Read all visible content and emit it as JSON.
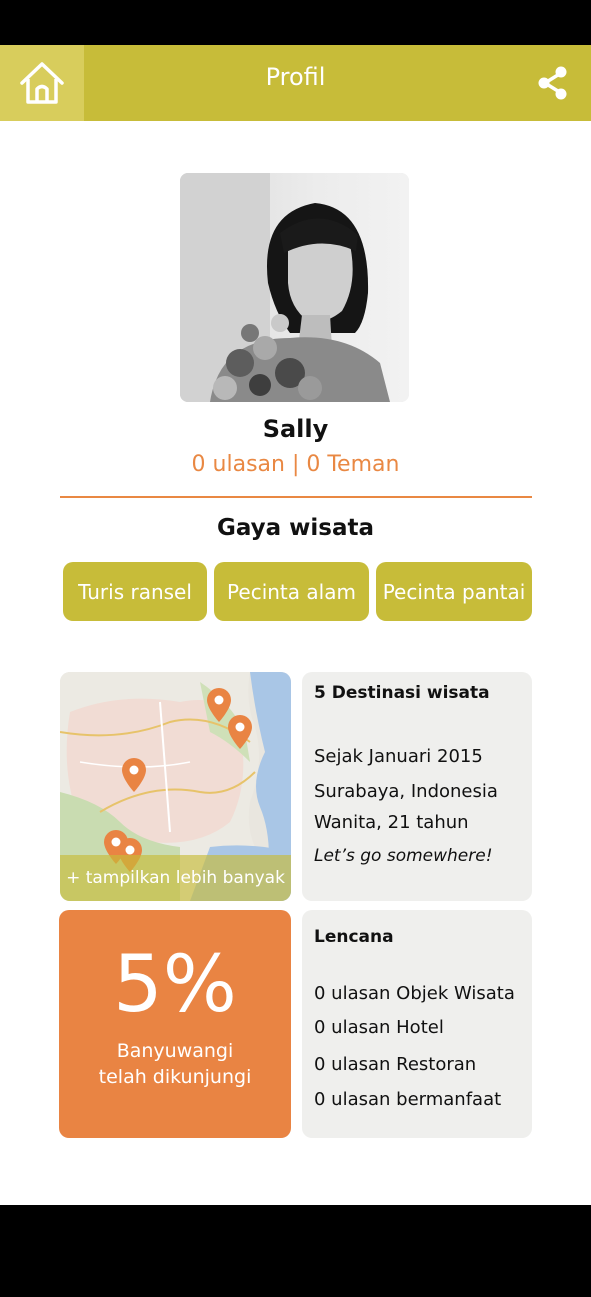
{
  "header": {
    "title": "Profil",
    "home_icon": "home-icon",
    "share_icon": "share-icon",
    "color": "#c7bc39"
  },
  "profile": {
    "name": "Sally",
    "stats": "0 ulasan | 0 Teman",
    "accent": "#e98843"
  },
  "travel_style": {
    "title": "Gaya wisata",
    "tags": [
      "Turis ransel",
      "Pecinta alam",
      "Pecinta pantai"
    ]
  },
  "map": {
    "show_more": "+ tampilkan lebih banyak",
    "pin_icon": "map-pin-icon"
  },
  "info": {
    "title": "5 Destinasi wisata",
    "since": "Sejak Januari 2015",
    "location": "Surabaya, Indonesia",
    "gender_age": "Wanita, 21 tahun",
    "motto": "Let’s go somewhere!"
  },
  "progress": {
    "percent": "5%",
    "line1": "Banyuwangi",
    "line2": "telah dikunjungi"
  },
  "badges": {
    "title": "Lencana",
    "items": [
      "0 ulasan Objek Wisata",
      "0 ulasan Hotel",
      "0 ulasan Restoran",
      "0 ulasan bermanfaat"
    ]
  }
}
